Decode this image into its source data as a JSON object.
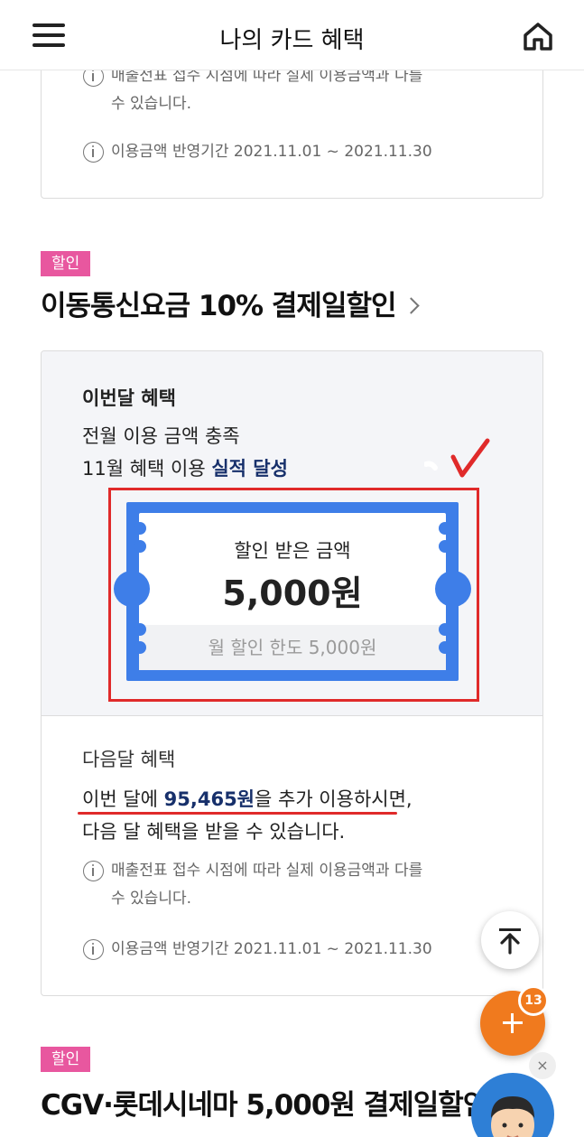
{
  "header": {
    "title": "나의 카드 혜택",
    "menu_icon": "hamburger-menu-icon",
    "home_icon": "home-icon"
  },
  "prev_card": {
    "note_partial_line1": "매출전표 접수 시점에 따라 실제 이용금액과 다를",
    "note_partial_line2": "수 있습니다.",
    "period": "이용금액 반영기간 2021.11.01 ~ 2021.11.30"
  },
  "section1": {
    "badge": "할인",
    "title": "이동통신요금 10% 결제일할인",
    "this_month": {
      "heading": "이번달 혜택",
      "line1": "전월 이용 금액 충족",
      "line2_prefix": "11월 혜택 이용 ",
      "line2_highlight": "실적 달성",
      "ticket": {
        "label": "할인 받은 금액",
        "amount": "5,000원",
        "limit": "월 할인 한도 5,000원"
      }
    },
    "next_month": {
      "heading": "다음달 혜택",
      "line1_prefix": "이번 달에 ",
      "line1_amount": "95,465원",
      "line1_suffix": "을 추가 이용하시면,",
      "line2": "다음 달 혜택을 받을 수 있습니다.",
      "note_line1": "매출전표 접수 시점에 따라 실제 이용금액과 다를",
      "note_line2": "수 있습니다.",
      "period": "이용금액 반영기간 2021.11.01 ~ 2021.11.30"
    }
  },
  "section2": {
    "badge": "할인",
    "title": "CGV·롯데시네마 5,000원 결제일할인"
  },
  "floating": {
    "fab_badge_count": "13",
    "close_label": "×"
  },
  "colors": {
    "accent_blue": "#3e7ee8",
    "navy": "#17306b",
    "badge_pink": "#e8579f",
    "fab_orange": "#f07a1e",
    "annotation_red": "#e02a2a"
  }
}
